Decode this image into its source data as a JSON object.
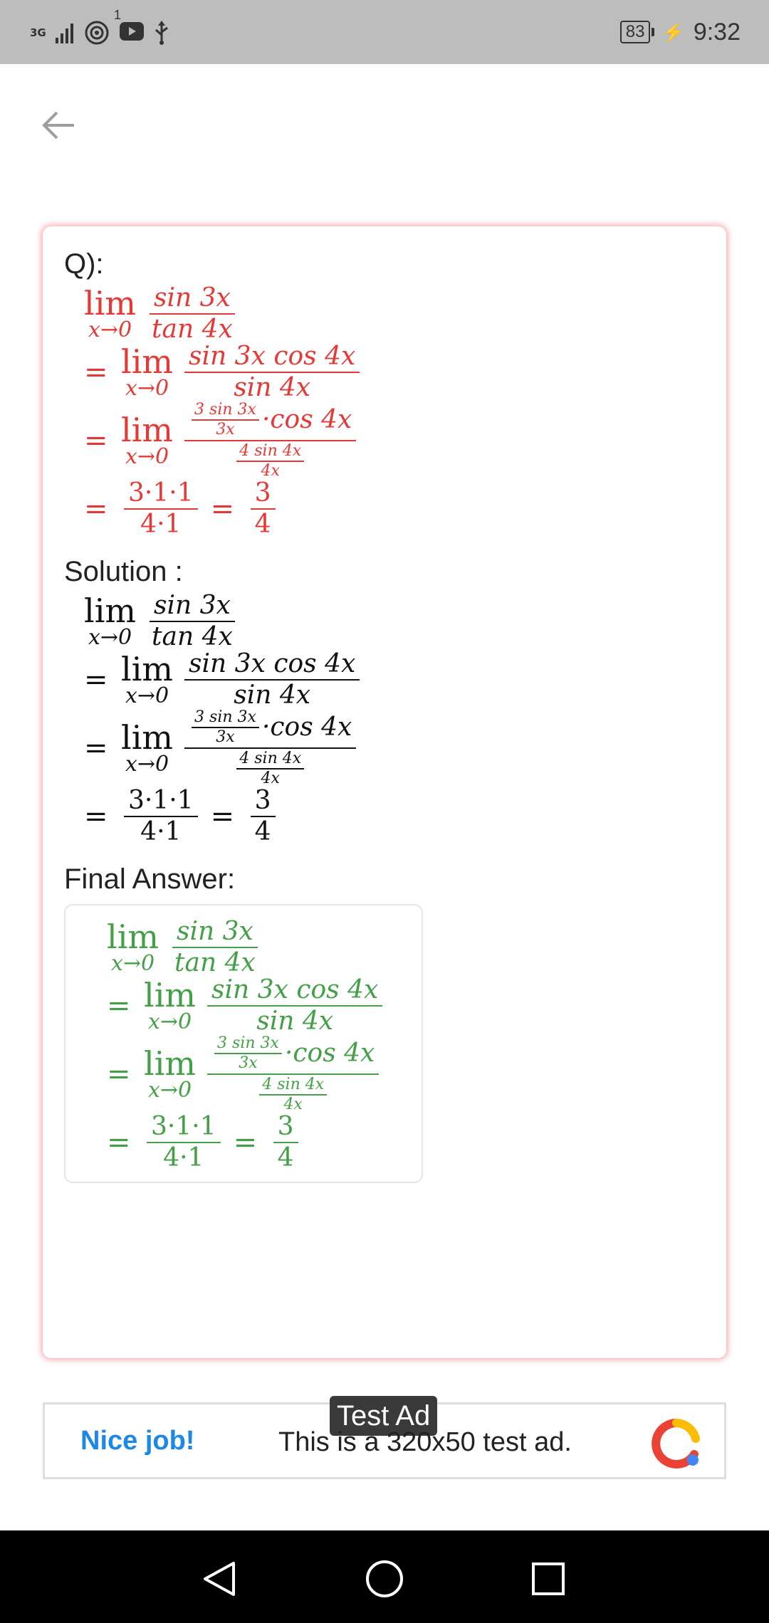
{
  "status_bar": {
    "network_label": "3G",
    "notification_count": "1",
    "battery_level": "83",
    "time": "9:32"
  },
  "sections": {
    "question_label": "Q):",
    "solution_label": "Solution :",
    "final_answer_label": "Final Answer:"
  },
  "math": {
    "lim": "lim",
    "limit_sub": "x→0",
    "equals": "=",
    "line1_num": "sin 3x",
    "line1_den": "tan 4x",
    "line2_num": "sin 3x cos 4x",
    "line2_den": "sin 4x",
    "line3_inner_num_top": "3 sin 3x",
    "line3_inner_num_bottom": "3x",
    "line3_cos": "·cos 4x",
    "line3_inner_den_top": "4 sin 4x",
    "line3_inner_den_bottom": "4x",
    "line4_num": "3·1·1",
    "line4_den": "4·1",
    "result_num": "3",
    "result_den": "4"
  },
  "colors": {
    "question": "#e53935",
    "solution": "#111111",
    "answer": "#43a047",
    "card_glow": "#f07878"
  },
  "ad": {
    "tag": "Test Ad",
    "nice_label": "Nice job!",
    "text": "This is a 320x50 test ad."
  },
  "icons": [
    "back-arrow-icon",
    "signal-icon",
    "hotspot-icon",
    "youtube-icon",
    "usb-icon",
    "charging-icon",
    "nav-back-icon",
    "nav-home-icon",
    "nav-recents-icon",
    "ad-logo-icon"
  ]
}
